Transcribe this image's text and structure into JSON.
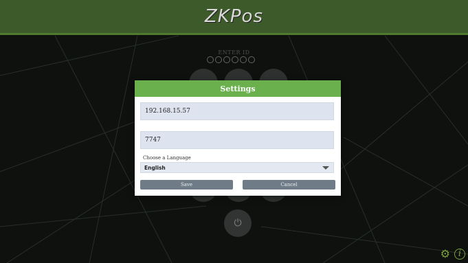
{
  "app": {
    "logo_text": "ZKPos",
    "logo_prefix": "ZK",
    "logo_suffix": "Pos"
  },
  "login": {
    "enter_id_label": "ENTER ID",
    "pin_dots": 6
  },
  "dialog": {
    "title": "Settings",
    "server_ip": "192.168.15.57",
    "port": "7747",
    "language_label": "Choose a Language",
    "language_selected": "English",
    "save_label": "Save",
    "cancel_label": "Cancel"
  },
  "icons": {
    "power": "power-icon",
    "settings": "gear-icon",
    "info": "info-icon"
  },
  "colors": {
    "header_green": "#3d5b2a",
    "dialog_green": "#6ab04c",
    "button_gray": "#6f7c88",
    "field_bg": "#dde3ef"
  }
}
